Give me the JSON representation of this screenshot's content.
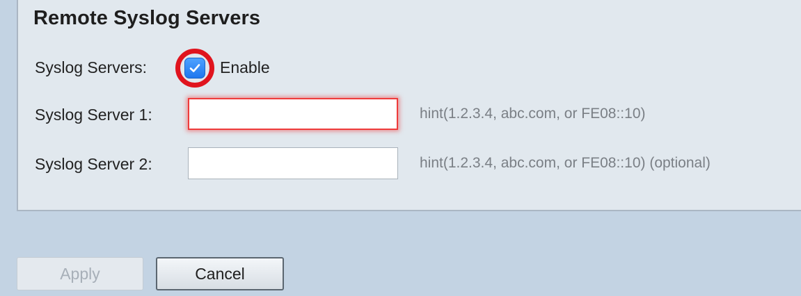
{
  "section": {
    "title": "Remote Syslog Servers"
  },
  "syslog_servers": {
    "label": "Syslog Servers:",
    "checkbox_checked": true,
    "checkbox_label": "Enable",
    "checkbox_color": "#2f8bff",
    "highlight_ring_color": "#e0141e"
  },
  "server1": {
    "label": "Syslog Server 1:",
    "value": "",
    "hint": "hint(1.2.3.4, abc.com, or FE08::10)",
    "state": "invalid"
  },
  "server2": {
    "label": "Syslog Server 2:",
    "value": "",
    "hint": "hint(1.2.3.4, abc.com, or FE08::10) (optional)"
  },
  "buttons": {
    "apply_label": "Apply",
    "apply_enabled": false,
    "cancel_label": "Cancel"
  }
}
